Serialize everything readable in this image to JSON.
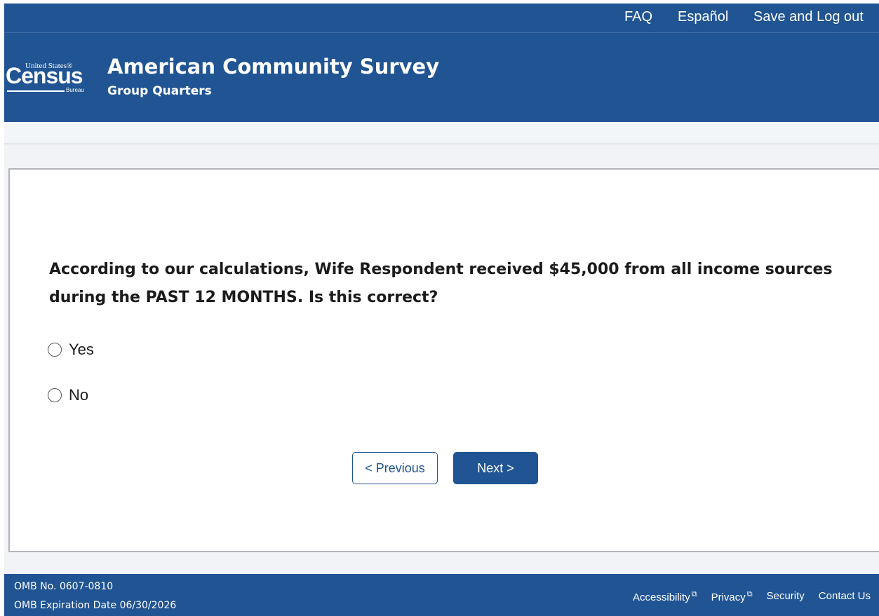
{
  "topnav": {
    "faq": "FAQ",
    "spanish": "Español",
    "logout": "Save and Log out"
  },
  "logo": {
    "united_states": "United States®",
    "census": "Census",
    "bureau": "Bureau"
  },
  "header": {
    "title": "American Community Survey",
    "subtitle": "Group Quarters"
  },
  "question": {
    "text": "According to our calculations, Wife Respondent received $45,000 from all income sources during the PAST 12 MONTHS. Is this correct?",
    "options": [
      {
        "label": "Yes",
        "selected": false
      },
      {
        "label": "No",
        "selected": false
      }
    ]
  },
  "buttons": {
    "previous": "< Previous",
    "next": "Next >"
  },
  "footer": {
    "omb_number": "OMB No. 0607-0810",
    "omb_expiration": "OMB Expiration Date 06/30/2026",
    "links": [
      {
        "label": "Accessibility",
        "icon": "external-link-icon"
      },
      {
        "label": "Privacy",
        "icon": "external-link-icon"
      },
      {
        "label": "Security"
      },
      {
        "label": "Contact Us"
      }
    ]
  },
  "colors": {
    "brand": "#205493",
    "page_background": "#f1f3f6",
    "card_border": "#b1b4b8"
  }
}
